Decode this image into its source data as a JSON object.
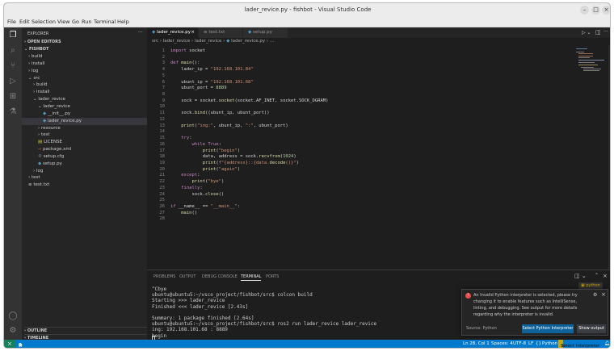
{
  "window": {
    "title": "lader_revice.py - fishbot - Visual Studio Code"
  },
  "menu": [
    "File",
    "Edit",
    "Selection",
    "View",
    "Go",
    "Run",
    "Terminal",
    "Help"
  ],
  "sidebar": {
    "title": "EXPLORER",
    "open_editors": "OPEN EDITORS",
    "root": "FISHBOT",
    "tree": [
      {
        "label": "build",
        "type": "folder",
        "depth": 1
      },
      {
        "label": "install",
        "type": "folder",
        "depth": 1
      },
      {
        "label": "log",
        "type": "folder",
        "depth": 1
      },
      {
        "label": "src",
        "type": "folder-open",
        "depth": 1
      },
      {
        "label": "build",
        "type": "folder",
        "depth": 2
      },
      {
        "label": "install",
        "type": "folder",
        "depth": 2
      },
      {
        "label": "lader_revice",
        "type": "folder-open",
        "depth": 2
      },
      {
        "label": "lader_revice",
        "type": "folder-open",
        "depth": 3
      },
      {
        "label": "__init__.py",
        "type": "py",
        "depth": 4
      },
      {
        "label": "lader_revice.py",
        "type": "py",
        "depth": 4,
        "selected": true
      },
      {
        "label": "resource",
        "type": "folder",
        "depth": 3
      },
      {
        "label": "test",
        "type": "folder",
        "depth": 3
      },
      {
        "label": "LICENSE",
        "type": "license",
        "depth": 3
      },
      {
        "label": "package.xml",
        "type": "xml",
        "depth": 3
      },
      {
        "label": "setup.cfg",
        "type": "cfg",
        "depth": 3
      },
      {
        "label": "setup.py",
        "type": "py",
        "depth": 3
      },
      {
        "label": "log",
        "type": "folder",
        "depth": 2
      },
      {
        "label": "test",
        "type": "folder",
        "depth": 1
      },
      {
        "label": "test.txt",
        "type": "txt",
        "depth": 1
      }
    ],
    "outline": "OUTLINE",
    "timeline": "TIMELINE"
  },
  "tabs": [
    {
      "label": "lader_revice.py",
      "active": true
    },
    {
      "label": "test.txt",
      "active": false
    },
    {
      "label": "setup.py",
      "active": false
    }
  ],
  "breadcrumb": [
    "src",
    "lader_revice",
    "lader_revice",
    "lader_revice.py",
    "..."
  ],
  "code_lines": [
    "import socket",
    "",
    "def main():",
    "    lader_ip = \"192.168.101.84\"",
    "",
    "    ubunt_ip = \"192.168.101.68\"",
    "    ubunt_port = 8889",
    "",
    "    sock = socket.socket(socket.AF_INET, socket.SOCK_DGRAM)",
    "",
    "    sock.bind((ubunt_ip, ubunt_port))",
    "",
    "    print(\"ing:\", ubunt_ip, \":\", ubunt_port)",
    "",
    "    try:",
    "        while True:",
    "            print(\"begin\")",
    "            data, address = sock.recvfrom(1024)",
    "            print(f\"{address}::{data.decode()}\")",
    "            print(\"again\")",
    "    except:",
    "        print(\"bye\")",
    "    finally:",
    "        sock.close()",
    "",
    "if __name__ == \"__main__\":",
    "    main()",
    ""
  ],
  "panel": {
    "tabs": [
      "PROBLEMS",
      "OUTPUT",
      "DEBUG CONSOLE",
      "TERMINAL",
      "PORTS"
    ],
    "active_tab": "TERMINAL",
    "terminal_name": "python",
    "terminal_lines": [
      "^Cbye",
      "ubuntu@ubuntu5:~/vsco_project/fishbot/src$ colcon build",
      "Starting >>> lader_revice",
      "Finished <<< lader_revice [2.43s]",
      "",
      "Summary: 1 package finished [2.64s]",
      "ubuntu@ubuntu5:~/vsco_project/fishbot/src$ ros2 run lader_revice lader_revice",
      "ing: 192.168.101.68 : 8889",
      "begin"
    ]
  },
  "notification": {
    "message": "An Invalid Python interpreter is selected, please try changing it to enable features such as IntelliSense, linting, and debugging. See output for more details regarding why the interpreter is invalid.",
    "source": "Source: Python",
    "primary_button": "Select Python Interpreter",
    "secondary_button": "Show output"
  },
  "statusbar": {
    "remote": "⨉",
    "errors": "0",
    "warnings": "0",
    "no_problems": "0",
    "cursor": "Ln 28, Col 1",
    "spaces": "Spaces: 4",
    "encoding": "UTF-8",
    "eol": "LF",
    "braces": "{}",
    "language": "Python",
    "interpreter": "Select Interpreter"
  },
  "colors": {
    "accent": "#007acc",
    "warning": "#cca700",
    "button": "#0e639c"
  }
}
